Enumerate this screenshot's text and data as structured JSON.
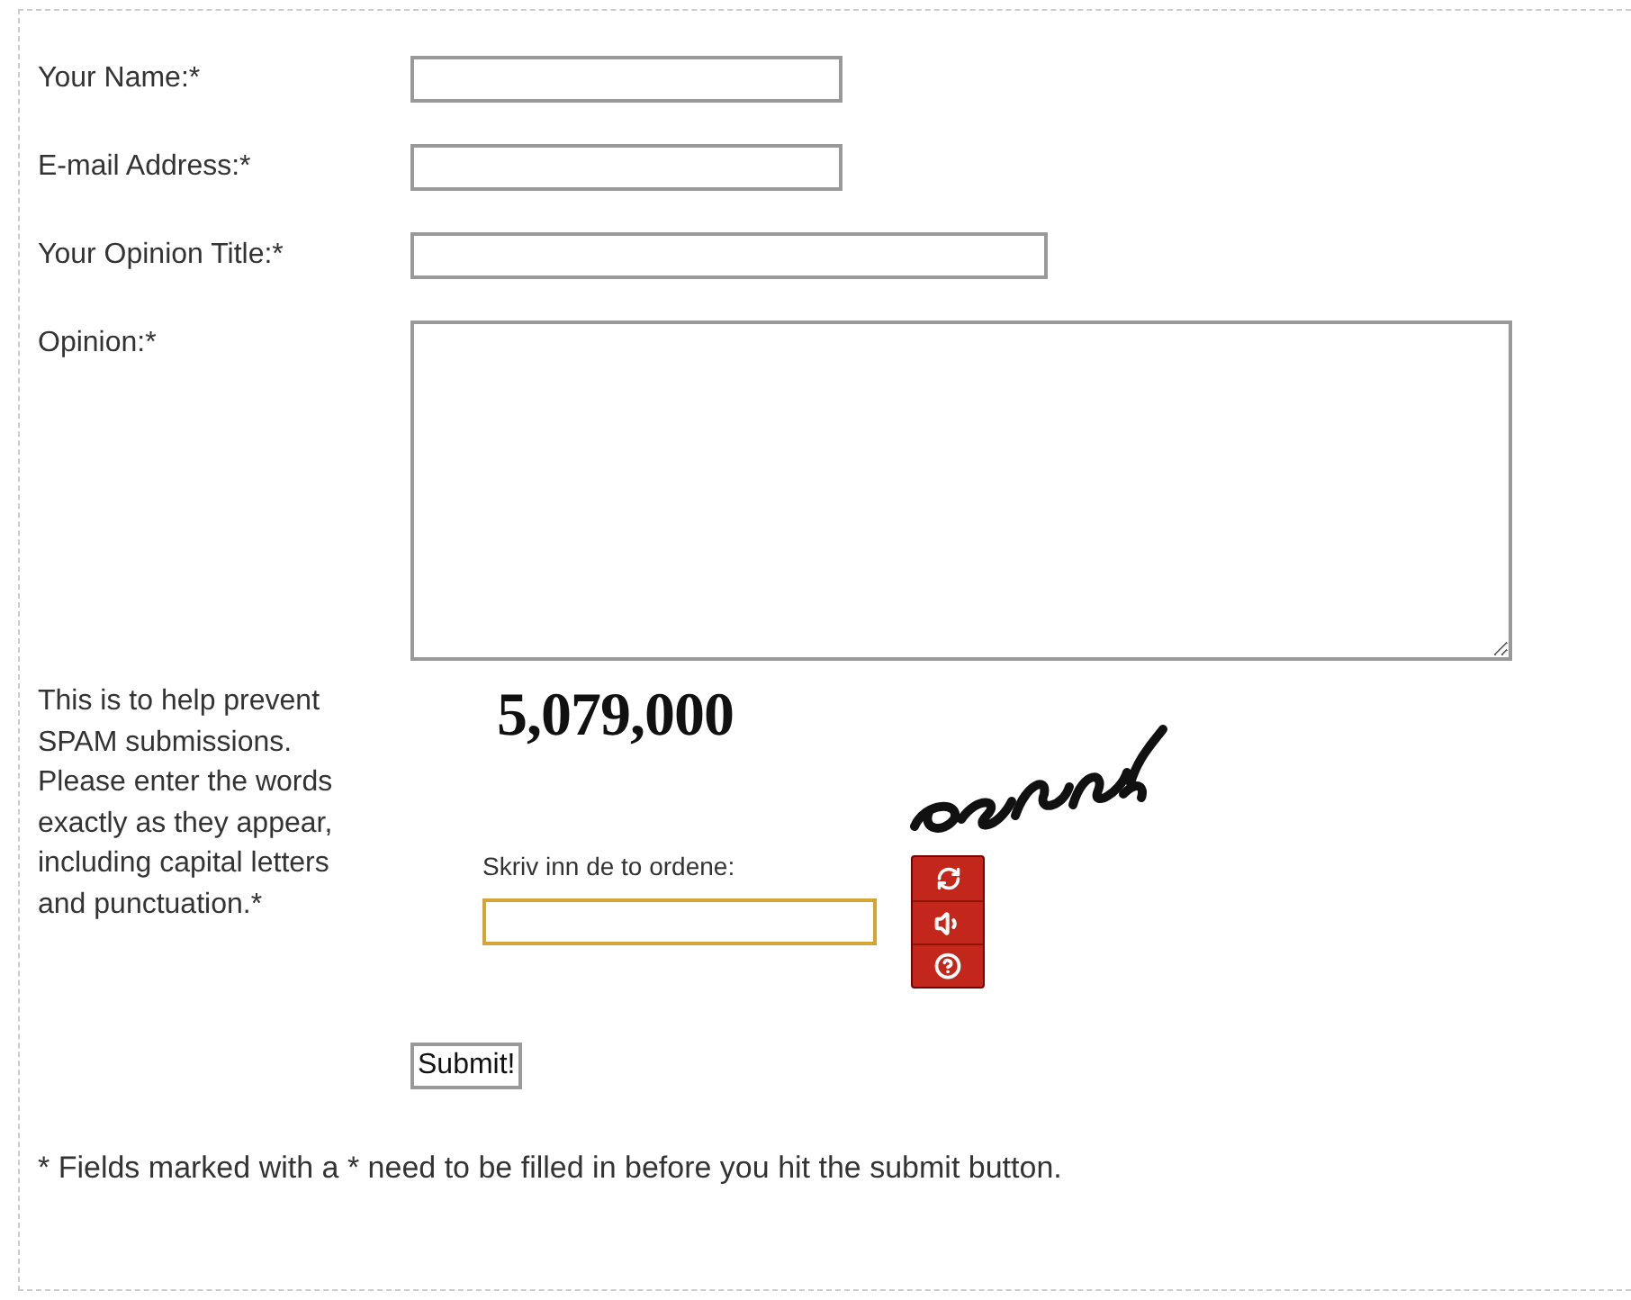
{
  "fields": [
    {
      "label": "Your Name:*",
      "kind": "short"
    },
    {
      "label": "E-mail Address:*",
      "kind": "short"
    },
    {
      "label": "Your Opinion Title:*",
      "kind": "long"
    },
    {
      "label": "Opinion:*",
      "kind": "area"
    }
  ],
  "captcha": {
    "help_text": "This is to help prevent SPAM submissions. Please enter the words exactly as they appear, including capital letters and punctuation.*",
    "number_text": "5,079,000",
    "prompt": "Skriv inn de to ordene:",
    "buttons": [
      {
        "kind": "refresh"
      },
      {
        "kind": "audio"
      },
      {
        "kind": "help"
      }
    ]
  },
  "submit": "Submit!",
  "note": "* Fields marked with a * need to be filled in before you hit the submit button."
}
